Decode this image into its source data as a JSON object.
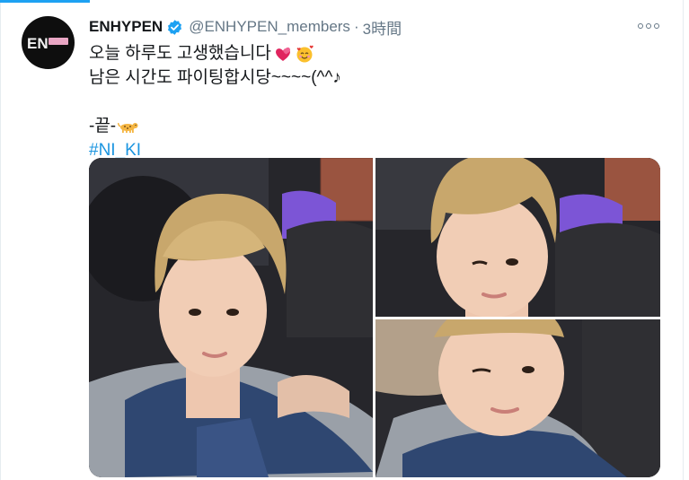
{
  "tweet": {
    "display_name": "ENHYPEN",
    "handle": "@ENHYPEN_members",
    "separator": "·",
    "time": "3時間",
    "lines": [
      "오늘 하루도 고생했습니다",
      "남은 시간도 파이팅합시당~~~~(^^♪",
      "-끝-"
    ],
    "hashtag": "#NI_KI",
    "avatar_text": "EN",
    "emoji": {
      "line1": [
        "heart-icon",
        "smiling-face-with-hearts-icon"
      ],
      "line3": [
        "leopard-icon"
      ]
    }
  },
  "colors": {
    "accent": "#1da1f2",
    "hashtag": "#1b95e0",
    "text": "#14171a",
    "muted": "#657786",
    "verified": "#1da1f2"
  }
}
